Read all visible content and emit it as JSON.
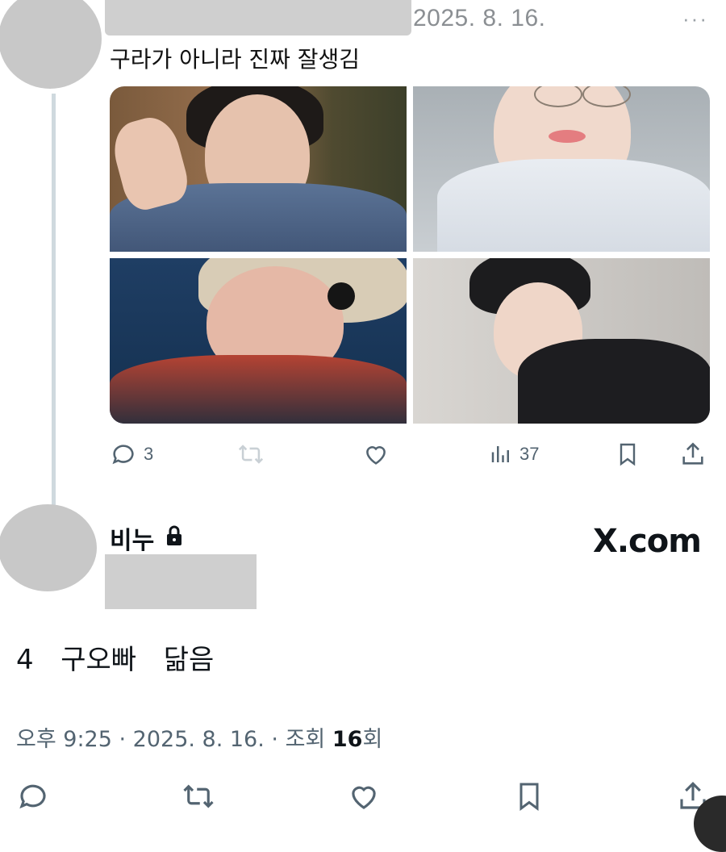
{
  "quoted_tweet": {
    "date": "2025. 8. 16.",
    "more_label": "···",
    "text": "구라가 아니라 진짜 잘생김",
    "actions": {
      "reply_count": "3",
      "views_count": "37"
    }
  },
  "main_tweet": {
    "author_name": "비누",
    "brand": "X.com",
    "text": "4  구오빠  닮음",
    "time": "오후 9:25",
    "date": "2025. 8. 16.",
    "views_label": "조회",
    "views_count": "16",
    "views_suffix": "회",
    "separator": " · "
  },
  "colors": {
    "icon_gray": "#536471",
    "thread_line": "#cfd9de",
    "redaction": "#cfcfcf"
  },
  "icons": [
    "reply-icon",
    "retweet-icon",
    "like-icon",
    "views-icon",
    "bookmark-icon",
    "share-icon",
    "lock-icon"
  ]
}
